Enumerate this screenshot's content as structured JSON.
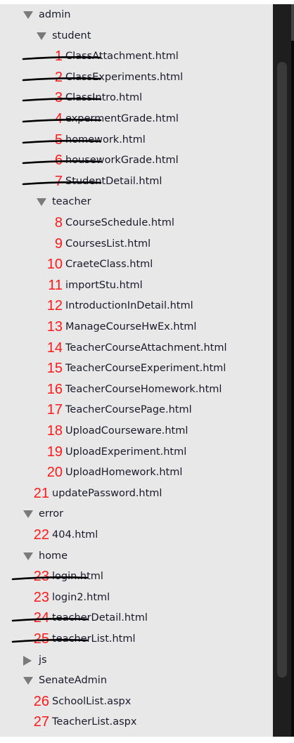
{
  "tree": [
    {
      "name": "admin",
      "type": "folder",
      "expanded": true,
      "level": 0
    },
    {
      "name": "student",
      "type": "folder",
      "expanded": true,
      "level": 1
    },
    {
      "name": "ClassAttachment.html",
      "type": "file",
      "level": 2,
      "number": "1",
      "struck": true
    },
    {
      "name": "ClassExperiments.html",
      "type": "file",
      "level": 2,
      "number": "2",
      "struck": true
    },
    {
      "name": "ClassIntro.html",
      "type": "file",
      "level": 2,
      "number": "3",
      "struck": true
    },
    {
      "name": "expermentGrade.html",
      "type": "file",
      "level": 2,
      "number": "4",
      "struck": true
    },
    {
      "name": "homework.html",
      "type": "file",
      "level": 2,
      "number": "5",
      "struck": true
    },
    {
      "name": "houseworkGrade.html",
      "type": "file",
      "level": 2,
      "number": "6",
      "struck": true
    },
    {
      "name": "StudentDetail.html",
      "type": "file",
      "level": 2,
      "number": "7",
      "struck": true
    },
    {
      "name": "teacher",
      "type": "folder",
      "expanded": true,
      "level": 1
    },
    {
      "name": "CourseSchedule.html",
      "type": "file",
      "level": 2,
      "number": "8",
      "struck": false
    },
    {
      "name": "CoursesList.html",
      "type": "file",
      "level": 2,
      "number": "9",
      "struck": false
    },
    {
      "name": "CraeteClass.html",
      "type": "file",
      "level": 2,
      "number": "10",
      "struck": false
    },
    {
      "name": "importStu.html",
      "type": "file",
      "level": 2,
      "number": "11",
      "struck": false
    },
    {
      "name": "IntroductionInDetail.html",
      "type": "file",
      "level": 2,
      "number": "12",
      "struck": false
    },
    {
      "name": "ManageCourseHwEx.html",
      "type": "file",
      "level": 2,
      "number": "13",
      "struck": false
    },
    {
      "name": "TeacherCourseAttachment.html",
      "type": "file",
      "level": 2,
      "number": "14",
      "struck": false
    },
    {
      "name": "TeacherCourseExperiment.html",
      "type": "file",
      "level": 2,
      "number": "15",
      "struck": false
    },
    {
      "name": "TeacherCourseHomework.html",
      "type": "file",
      "level": 2,
      "number": "16",
      "struck": false
    },
    {
      "name": "TeacherCoursePage.html",
      "type": "file",
      "level": 2,
      "number": "17",
      "struck": false
    },
    {
      "name": "UploadCourseware.html",
      "type": "file",
      "level": 2,
      "number": "18",
      "struck": false
    },
    {
      "name": "UploadExperiment.html",
      "type": "file",
      "level": 2,
      "number": "19",
      "struck": false
    },
    {
      "name": "UploadHomework.html",
      "type": "file",
      "level": 2,
      "number": "20",
      "struck": false
    },
    {
      "name": "updatePassword.html",
      "type": "file",
      "level": 1,
      "number": "21",
      "struck": false
    },
    {
      "name": "error",
      "type": "folder",
      "expanded": true,
      "level": 0
    },
    {
      "name": "404.html",
      "type": "file",
      "level": 1,
      "number": "22",
      "struck": false
    },
    {
      "name": "home",
      "type": "folder",
      "expanded": true,
      "level": 0
    },
    {
      "name": "login.html",
      "type": "file",
      "level": 1,
      "number": "23",
      "struck": true
    },
    {
      "name": "login2.html",
      "type": "file",
      "level": 1,
      "number": "23",
      "struck": false
    },
    {
      "name": "teacherDetail.html",
      "type": "file",
      "level": 1,
      "number": "24",
      "struck": true
    },
    {
      "name": "teacherList.html",
      "type": "file",
      "level": 1,
      "number": "25",
      "struck": true
    },
    {
      "name": "js",
      "type": "folder",
      "expanded": false,
      "level": 0
    },
    {
      "name": "SenateAdmin",
      "type": "folder",
      "expanded": true,
      "level": 0
    },
    {
      "name": "SchoolList.aspx",
      "type": "file",
      "level": 1,
      "number": "26",
      "struck": false
    },
    {
      "name": "TeacherList.aspx",
      "type": "file",
      "level": 1,
      "number": "27",
      "struck": false
    }
  ]
}
